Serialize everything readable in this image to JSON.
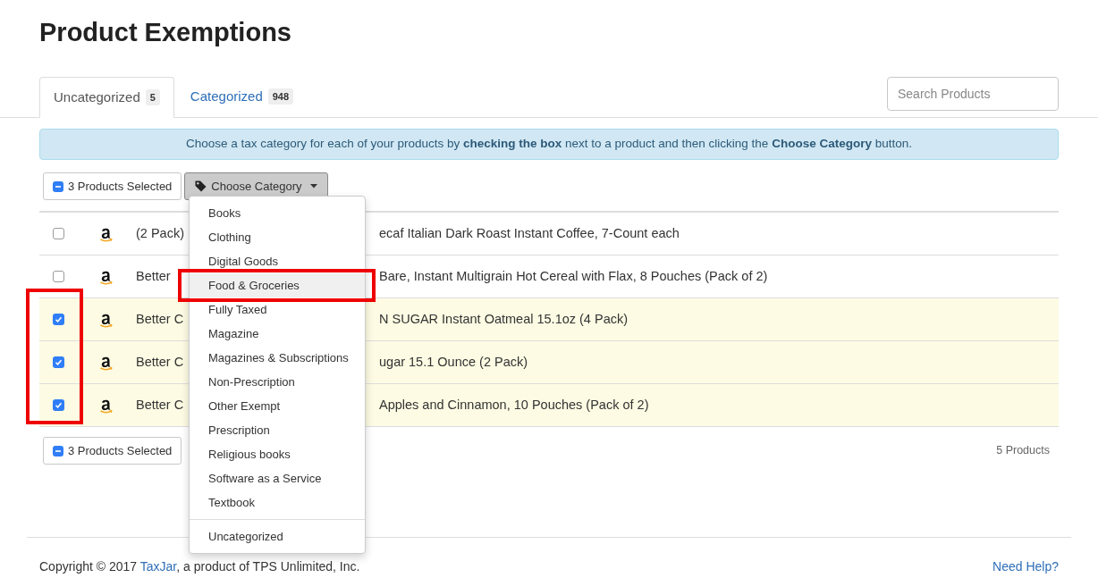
{
  "title": "Product Exemptions",
  "tabs": [
    {
      "label": "Uncategorized",
      "count": "5",
      "selected": true
    },
    {
      "label": "Categorized",
      "count": "948",
      "selected": false
    }
  ],
  "search": {
    "placeholder": "Search Products"
  },
  "alert": "Choose a tax category for each of your products by **checking the box** next to a product and then clicking the **Choose Category** button.",
  "selection_button": {
    "label": "3 Products Selected"
  },
  "category_button": {
    "label": "Choose Category",
    "expanded": true
  },
  "products": [
    {
      "checked": false,
      "name_start": "(2 Pack)",
      "name_end": "ecaf Italian Dark Roast Instant Coffee, 7-Count each"
    },
    {
      "checked": false,
      "name_start": "Better",
      "name_end": "Bare, Instant Multigrain Hot Cereal with Flax, 8 Pouches (Pack of 2)"
    },
    {
      "checked": true,
      "name_start": "Better C",
      "name_end": "N SUGAR Instant Oatmeal 15.1oz (4 Pack)"
    },
    {
      "checked": true,
      "name_start": "Better C",
      "name_end": "ugar 15.1 Ounce (2 Pack)"
    },
    {
      "checked": true,
      "name_start": "Better C",
      "name_end": "Apples and Cinnamon, 10 Pouches (Pack of 2)"
    }
  ],
  "bottom_selection_button": {
    "label": "3 Products Selected"
  },
  "product_count": "5 Products",
  "menu": [
    {
      "label": "Books",
      "selected": false
    },
    {
      "label": "Clothing",
      "selected": false
    },
    {
      "label": "Digital Goods",
      "selected": false
    },
    {
      "label": "Food & Groceries",
      "selected": true
    },
    {
      "label": "Fully Taxed",
      "selected": false
    },
    {
      "label": "Magazine",
      "selected": false
    },
    {
      "label": "Magazines & Subscriptions",
      "selected": false
    },
    {
      "label": "Non-Prescription",
      "selected": false
    },
    {
      "label": "Other Exempt",
      "selected": false
    },
    {
      "label": "Prescription",
      "selected": false
    },
    {
      "label": "Religious books",
      "selected": false
    },
    {
      "label": "Software as a Service",
      "selected": false
    },
    {
      "label": "Textbook",
      "selected": false
    },
    {
      "label": "Uncategorized",
      "selected": false,
      "divider_before": true
    }
  ],
  "footer": {
    "copyright_start": "Copyright © 2017 ",
    "link": "TaxJar",
    "copyright_end": ", a product of TPS Unlimited, Inc.",
    "help": "Need Help?"
  }
}
